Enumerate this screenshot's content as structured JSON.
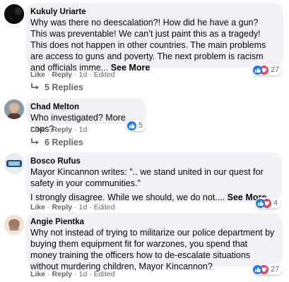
{
  "comments": [
    {
      "author": "Kukuly Uriarte",
      "text": "Why was there no deescalation?! How did he have a gun? This was preventable! We can’t just paint this as a tragedy! This does not happen in other countries. The main problems are access to guns and poverty. The next problem is racism and officials imme...",
      "see_more": "See More",
      "like": "Like",
      "reply": "Reply",
      "time": "1d",
      "edited": "Edited",
      "reactions": [
        "like",
        "love"
      ],
      "reaction_count": "27",
      "replies": "5 Replies"
    },
    {
      "author": "Chad Melton",
      "text": "Who investigated? More cops?",
      "like": "Like",
      "reply": "Reply",
      "time": "1d",
      "reactions": [
        "like"
      ],
      "reaction_count": "5",
      "replies": "6 Replies"
    },
    {
      "author": "Bosco Rufus",
      "text": "Mayor Kincannon writes: \".. we stand united in our quest for safety in your communities.\"",
      "text2": "I strongly disagree. While we should, we do not....",
      "see_more": "See More",
      "like": "Like",
      "reply": "Reply",
      "time": "1d",
      "edited": "Edited",
      "reactions": [
        "like",
        "love"
      ],
      "reaction_count": "4"
    },
    {
      "author": "Angie Pientka",
      "text": "Why not instead of trying to militarize our police department by buying them equipment fit for warzones, you spend that money training the officers how to de-escalate situations without murdering children, Mayor Kincannon?",
      "like": "Like",
      "reply": "Reply",
      "time": "1d",
      "edited": "Edited",
      "reactions": [
        "like",
        "love"
      ],
      "reaction_count": "27"
    }
  ],
  "colors": {
    "bubble": "#f0f2f5",
    "like_blue": "#1877f2",
    "love_red": "#f33e58",
    "meta_gray": "#65676b"
  }
}
